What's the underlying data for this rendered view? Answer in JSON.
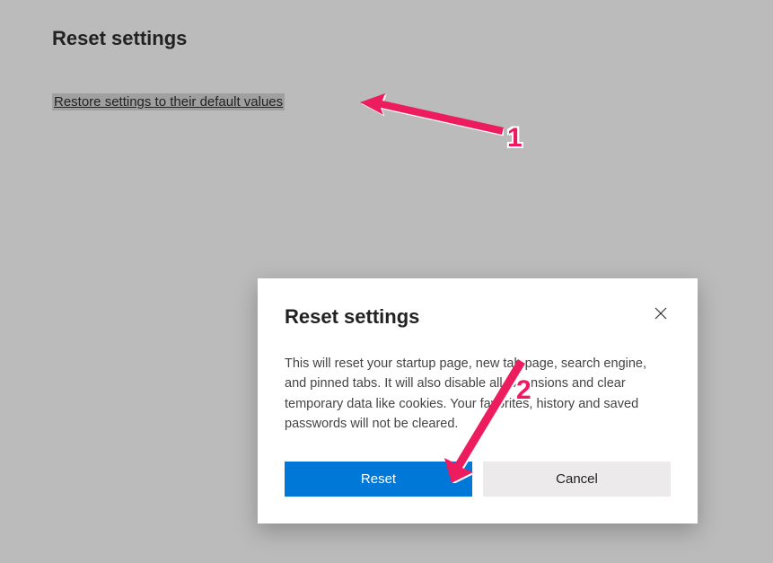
{
  "page": {
    "title": "Reset settings",
    "link": "Restore settings to their default values"
  },
  "dialog": {
    "title": "Reset settings",
    "body": "This will reset your startup page, new tab page, search engine, and pinned tabs. It will also disable all extensions and clear temporary data like cookies. Your favorites, history and saved passwords will not be cleared.",
    "reset_label": "Reset",
    "cancel_label": "Cancel"
  },
  "annotations": {
    "label1": "1",
    "label2": "2"
  }
}
